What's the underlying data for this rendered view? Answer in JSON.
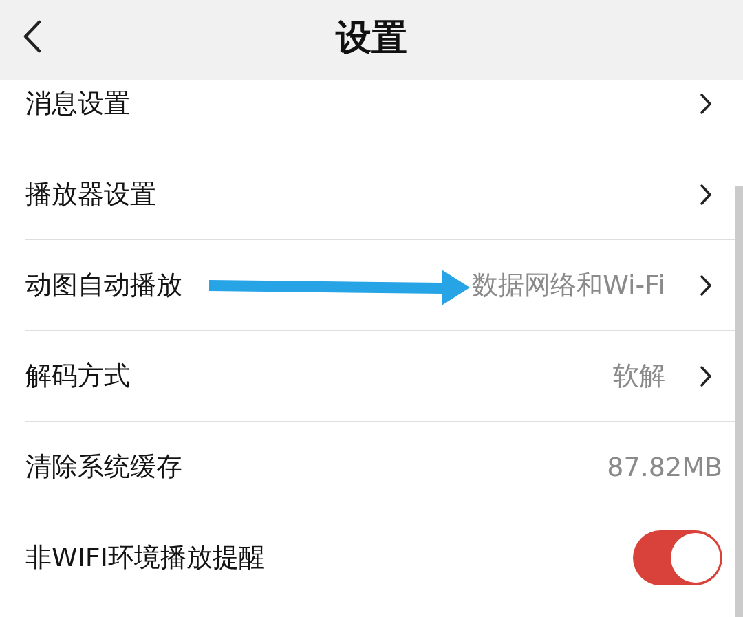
{
  "header": {
    "title": "设置"
  },
  "rows": [
    {
      "kind": "link",
      "label": "消息设置"
    },
    {
      "kind": "link",
      "label": "播放器设置"
    },
    {
      "kind": "link",
      "label": "动图自动播放",
      "value": "数据网络和Wi-Fi"
    },
    {
      "kind": "link",
      "label": "解码方式",
      "value": "软解"
    },
    {
      "kind": "info",
      "label": "清除系统缓存",
      "value": "87.82MB"
    },
    {
      "kind": "toggle",
      "label": "非WIFI环境播放提醒",
      "on": true
    }
  ]
}
